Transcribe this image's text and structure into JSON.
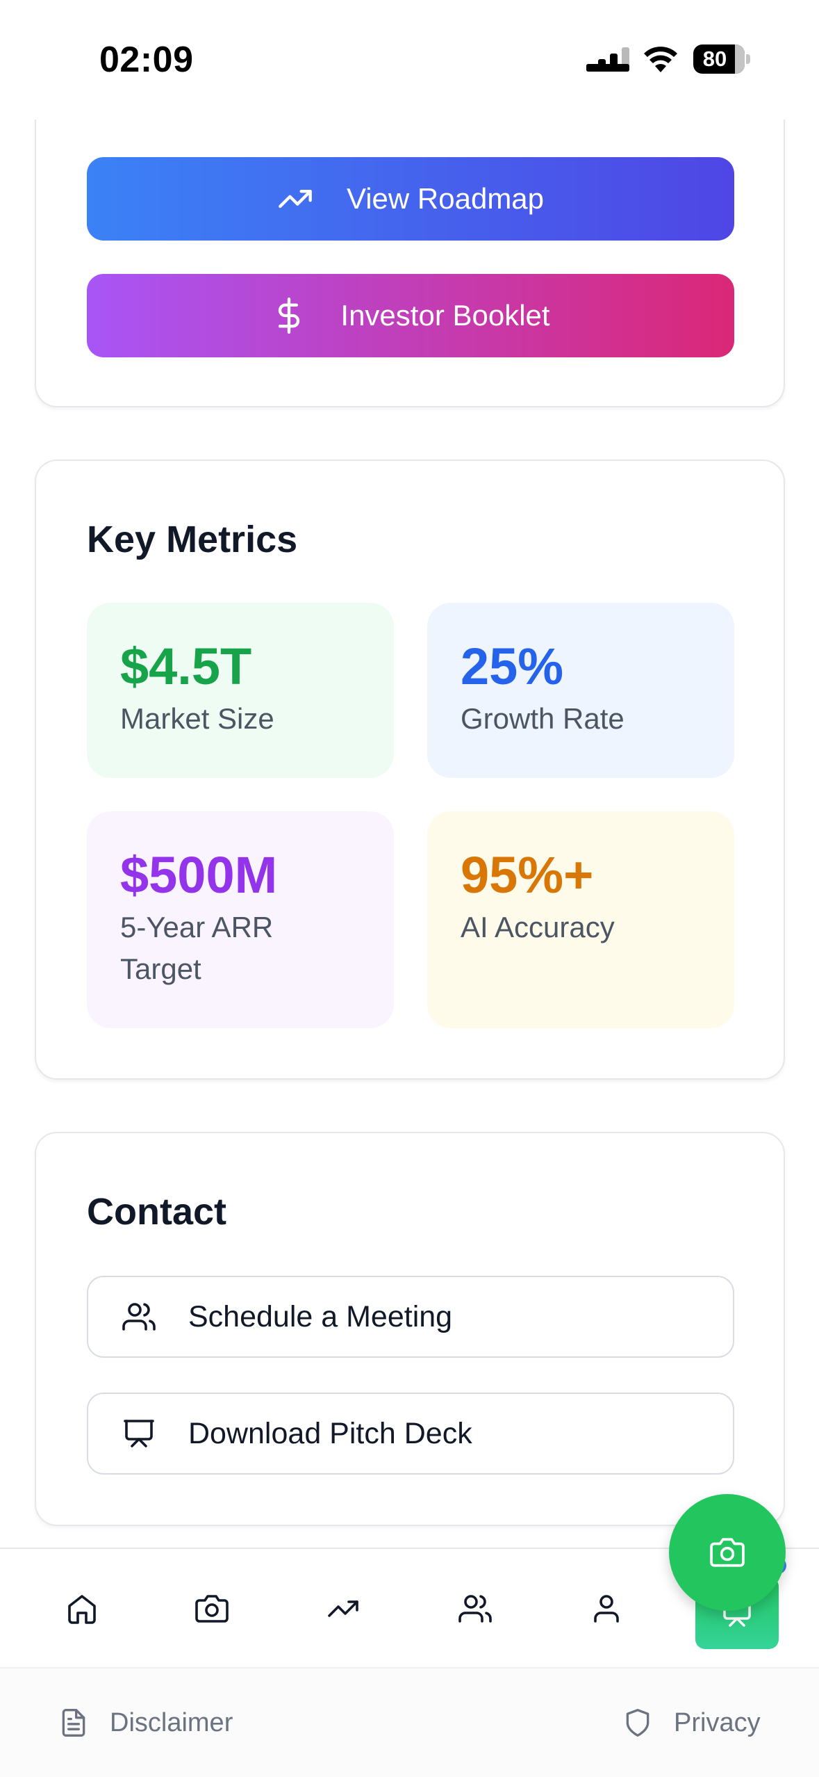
{
  "status_bar": {
    "time": "02:09",
    "battery_level": "80",
    "icons": [
      "signal-icon",
      "wifi-icon",
      "battery-icon"
    ]
  },
  "actions": {
    "roadmap_label": "View Roadmap",
    "roadmap_icon": "trending-up-icon",
    "booklet_label": "Investor Booklet",
    "booklet_icon": "dollar-icon"
  },
  "metrics": {
    "title": "Key Metrics",
    "items": [
      {
        "value": "$4.5T",
        "label": "Market Size",
        "color": "#16a34a",
        "bg": "#effcf3"
      },
      {
        "value": "25%",
        "label": "Growth Rate",
        "color": "#2563eb",
        "bg": "#eef5ff"
      },
      {
        "value": "$500M",
        "label": "5-Year ARR Target",
        "color": "#9333ea",
        "bg": "#f9f4ff"
      },
      {
        "value": "95%+",
        "label": "AI Accuracy",
        "color": "#d97706",
        "bg": "#fefbea"
      }
    ]
  },
  "contact": {
    "title": "Contact",
    "schedule_label": "Schedule a Meeting",
    "schedule_icon": "users-icon",
    "download_label": "Download Pitch Deck",
    "download_icon": "presentation-icon"
  },
  "bottom_nav": {
    "items": [
      "home-icon",
      "camera-icon",
      "trending-up-icon",
      "users-icon",
      "user-icon",
      "presentation-icon"
    ],
    "active_color": "#22c55e"
  },
  "fab": {
    "icon": "camera-icon",
    "color": "#22c55e"
  },
  "footer": {
    "disclaimer_label": "Disclaimer",
    "privacy_label": "Privacy"
  }
}
